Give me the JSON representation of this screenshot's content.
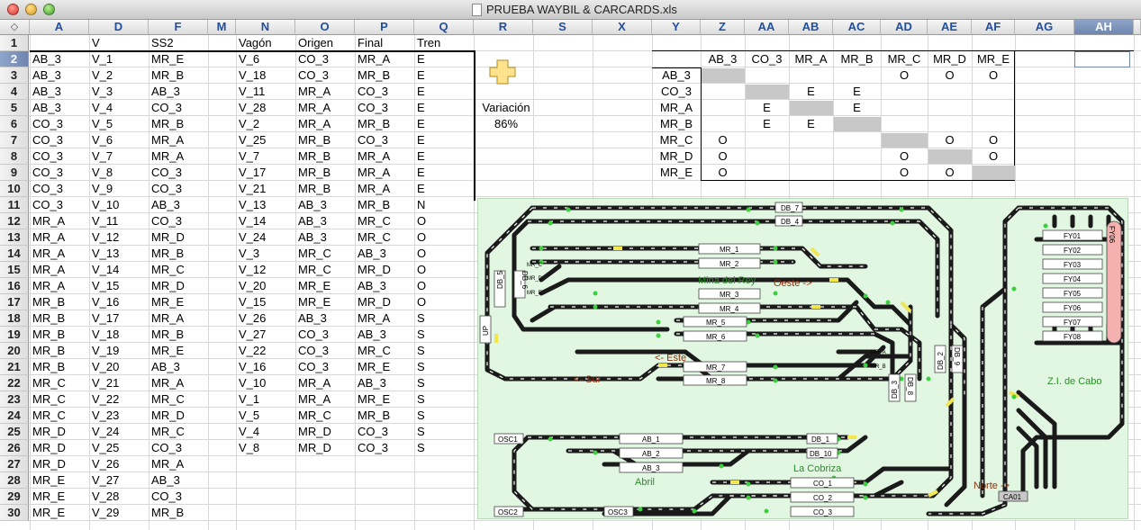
{
  "window": {
    "title": "PRUEBA WAYBIL & CARCARDS.xls"
  },
  "columns": [
    "A",
    "D",
    "F",
    "M",
    "N",
    "O",
    "P",
    "Q",
    "R",
    "S",
    "X",
    "Y",
    "Z",
    "AA",
    "AB",
    "AC",
    "AD",
    "AE",
    "AF",
    "AG",
    "AH"
  ],
  "selected_column": "AH",
  "selected_row": 2,
  "rows": [
    1,
    2,
    3,
    4,
    5,
    6,
    7,
    8,
    9,
    10,
    11,
    12,
    13,
    14,
    15,
    16,
    17,
    18,
    19,
    20,
    21,
    22,
    23,
    24,
    25,
    26,
    27,
    28,
    29,
    30
  ],
  "headers": {
    "a": "",
    "d": "V",
    "f": "SS2",
    "n": "Vagón",
    "o": "Origen",
    "p": "Final",
    "q": "Tren"
  },
  "col_a": [
    "AB_3",
    "AB_3",
    "AB_3",
    "AB_3",
    "CO_3",
    "CO_3",
    "CO_3",
    "CO_3",
    "CO_3",
    "CO_3",
    "MR_A",
    "MR_A",
    "MR_A",
    "MR_A",
    "MR_A",
    "MR_B",
    "MR_B",
    "MR_B",
    "MR_B",
    "MR_B",
    "MR_C",
    "MR_C",
    "MR_C",
    "MR_D",
    "MR_D",
    "MR_D",
    "MR_E",
    "MR_E",
    "MR_E"
  ],
  "col_d": [
    "V_1",
    "V_2",
    "V_3",
    "V_4",
    "V_5",
    "V_6",
    "V_7",
    "V_8",
    "V_9",
    "V_10",
    "V_11",
    "V_12",
    "V_13",
    "V_14",
    "V_15",
    "V_16",
    "V_17",
    "V_18",
    "V_19",
    "V_20",
    "V_21",
    "V_22",
    "V_23",
    "V_24",
    "V_25",
    "V_26",
    "V_27",
    "V_28",
    "V_29"
  ],
  "col_f": [
    "MR_E",
    "MR_B",
    "AB_3",
    "CO_3",
    "MR_B",
    "MR_A",
    "MR_A",
    "CO_3",
    "CO_3",
    "AB_3",
    "CO_3",
    "MR_D",
    "MR_B",
    "MR_C",
    "MR_D",
    "MR_E",
    "MR_A",
    "MR_B",
    "MR_E",
    "AB_3",
    "MR_A",
    "MR_C",
    "MR_D",
    "MR_C",
    "CO_3",
    "MR_A",
    "AB_3",
    "CO_3",
    "MR_B"
  ],
  "col_n": [
    "V_6",
    "V_18",
    "V_11",
    "V_28",
    "V_2",
    "V_25",
    "V_7",
    "V_17",
    "V_21",
    "V_13",
    "V_14",
    "V_24",
    "V_3",
    "V_12",
    "V_20",
    "V_15",
    "V_26",
    "V_27",
    "V_22",
    "V_16",
    "V_10",
    "V_1",
    "V_5",
    "V_4",
    "V_8"
  ],
  "col_o": [
    "CO_3",
    "CO_3",
    "MR_A",
    "MR_A",
    "MR_A",
    "MR_B",
    "MR_B",
    "MR_B",
    "MR_B",
    "AB_3",
    "AB_3",
    "AB_3",
    "MR_C",
    "MR_C",
    "MR_E",
    "MR_E",
    "AB_3",
    "CO_3",
    "CO_3",
    "CO_3",
    "MR_A",
    "MR_A",
    "MR_C",
    "MR_D",
    "MR_D"
  ],
  "col_p": [
    "MR_A",
    "MR_B",
    "CO_3",
    "CO_3",
    "MR_B",
    "CO_3",
    "MR_A",
    "MR_A",
    "MR_A",
    "MR_B",
    "MR_C",
    "MR_C",
    "AB_3",
    "MR_D",
    "AB_3",
    "MR_D",
    "MR_A",
    "AB_3",
    "MR_C",
    "MR_E",
    "AB_3",
    "MR_E",
    "MR_B",
    "CO_3",
    "CO_3"
  ],
  "col_q": [
    "E",
    "E",
    "E",
    "E",
    "E",
    "E",
    "E",
    "E",
    "E",
    "N",
    "O",
    "O",
    "O",
    "O",
    "O",
    "O",
    "S",
    "S",
    "S",
    "S",
    "S",
    "S",
    "S",
    "S",
    "S"
  ],
  "variation": {
    "label": "Variación",
    "value": "86%"
  },
  "matrix": {
    "col_headers": [
      "AB_3",
      "CO_3",
      "MR_A",
      "MR_B",
      "MR_C",
      "MR_D",
      "MR_E"
    ],
    "row_headers": [
      "AB_3",
      "CO_3",
      "MR_A",
      "MR_B",
      "MR_C",
      "MR_D",
      "MR_E"
    ],
    "cells": [
      [
        "",
        "",
        "",
        "",
        "O",
        "O",
        "O"
      ],
      [
        "",
        "",
        "E",
        "E",
        "",
        "",
        ""
      ],
      [
        "",
        "E",
        "",
        "E",
        "",
        "",
        ""
      ],
      [
        "",
        "E",
        "E",
        "",
        "",
        "",
        ""
      ],
      [
        "O",
        "",
        "",
        "",
        "",
        "O",
        "O"
      ],
      [
        "O",
        "",
        "",
        "",
        "O",
        "",
        "O"
      ],
      [
        "O",
        "",
        "",
        "",
        "O",
        "O",
        ""
      ]
    ]
  },
  "layout": {
    "labels": {
      "mina": "Mina del Rey",
      "oeste": "Oeste ->",
      "este": "<- Este",
      "sur": "<- Sur",
      "zi": "Z.I. de Cabo",
      "cobriza": "La Cobriza",
      "abril": "Abril",
      "norte": "Norte ->"
    },
    "boxes": {
      "db7": "DB_7",
      "db4": "DB_4",
      "mr1": "MR_1",
      "mr2": "MR_2",
      "mr3": "MR_3",
      "mr4": "MR_4",
      "mr5": "MR_5",
      "mr6": "MR_6",
      "mr7": "MR_7",
      "mr8": "MR_8",
      "db5": "DB_5",
      "db6": "DB_6",
      "db2": "DB_2",
      "db9": "DB_9",
      "db3": "DB_3",
      "db8": "DB_8",
      "db1": "DB_1",
      "db10": "DB_10",
      "ab1": "AB_1",
      "ab2": "AB_2",
      "ab3": "AB_3",
      "co1": "CO_1",
      "co2": "CO_2",
      "co3": "CO_3",
      "osc1": "OSC1",
      "osc2": "OSC2",
      "osc3": "OSC3",
      "ca01": "CA01",
      "fy": "FY06",
      "up": "UP",
      "fy01": "FY01",
      "fy02": "FY02",
      "fy03": "FY03",
      "fy04": "FY04",
      "fy05": "FY05",
      "fy06": "FY06",
      "fy07": "FY07",
      "fy08": "FY08"
    },
    "tiny": {
      "mrc": "MR_C",
      "mrd": "MR_D",
      "mre": "MR_E",
      "mra": "MR_A",
      "mrb": "MR_B"
    }
  },
  "colors": {
    "track": "#1a1a1a",
    "layout_bg": "#e2f7e2",
    "signal_green": "#3cd13c",
    "signal_yellow": "#f2e64a",
    "label_green": "#2a8c2a",
    "label_red": "#8b3010",
    "matrix_diag": "#c8c8c8",
    "selection": "#6f86b0"
  }
}
